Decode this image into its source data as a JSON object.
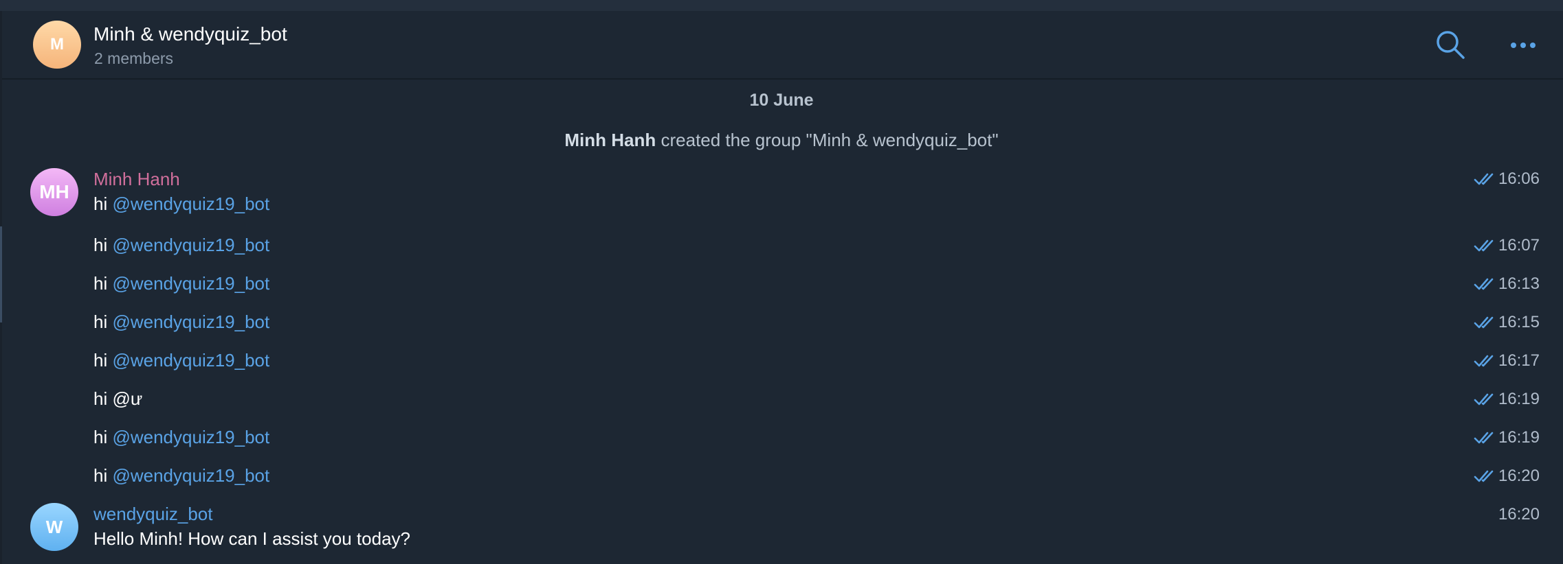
{
  "header": {
    "avatar_letter": "M",
    "title": "Minh & wendyquiz_bot",
    "subtitle": "2 members"
  },
  "date_separator": "10 June",
  "service_message": {
    "actor": "Minh Hanh",
    "text": " created the group \"Minh & wendyquiz_bot\""
  },
  "group1": {
    "avatar_initials": "MH",
    "sender": "Minh Hanh",
    "messages": [
      {
        "prefix": "hi ",
        "mention": "@wendyquiz19_bot",
        "time": "16:06"
      },
      {
        "prefix": "hi ",
        "mention": "@wendyquiz19_bot",
        "time": "16:07"
      },
      {
        "prefix": "hi ",
        "mention": "@wendyquiz19_bot",
        "time": "16:13"
      },
      {
        "prefix": "hi ",
        "mention": "@wendyquiz19_bot",
        "time": "16:15"
      },
      {
        "prefix": "hi ",
        "mention": "@wendyquiz19_bot",
        "time": "16:17"
      },
      {
        "prefix": "hi @ư",
        "mention": "",
        "time": "16:19"
      },
      {
        "prefix": "hi ",
        "mention": "@wendyquiz19_bot",
        "time": "16:19"
      },
      {
        "prefix": "hi ",
        "mention": "@wendyquiz19_bot",
        "time": "16:20"
      }
    ]
  },
  "group2": {
    "avatar_initials": "W",
    "sender": "wendyquiz_bot",
    "messages": [
      {
        "text": "Hello Minh! How can I assist you today?",
        "time": "16:20"
      }
    ]
  },
  "colors": {
    "background": "#1d2733",
    "accent": "#5aa3e6",
    "sender_pink": "#d16f9c"
  },
  "icons": {
    "search": "search-icon",
    "more": "more-icon",
    "read_check": "double-check-icon"
  }
}
